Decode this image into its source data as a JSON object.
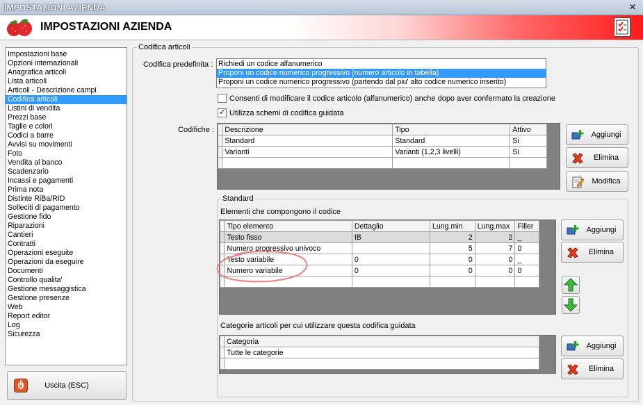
{
  "window": {
    "title": "IMPOSTAZIONI AZIENDA"
  },
  "header": {
    "title": "IMPOSTAZIONI AZIENDA"
  },
  "sidebar": {
    "items": [
      "Impostazioni base",
      "Opzioni internazionali",
      "Anagrafica articoli",
      "Lista articoli",
      "Articoli - Descrizione campi",
      "Codifica articoli",
      "Listini di vendita",
      "Prezzi base",
      "Taglie e colori",
      "Codici a barre",
      "Avvisi su movimenti",
      "Foto",
      "Vendita al banco",
      "Scadenzario",
      "Incassi e pagamenti",
      "Prima nota",
      "Distinte RiBa/RID",
      "Solleciti di pagamento",
      "Gestione fido",
      "Riparazioni",
      "Cantieri",
      "Contratti",
      "Operazioni eseguite",
      "Operazioni da eseguire",
      "Documenti",
      "Controllo qualita'",
      "Gestione messaggistica",
      "Gestione presenze",
      "Web",
      "Report editor",
      "Log",
      "Sicurezza"
    ],
    "selected_index": 5
  },
  "exit_button": {
    "label": "Uscita (ESC)"
  },
  "codifica": {
    "group_label": "Codifica articoli",
    "predefinita_label": "Codifica predefinita :",
    "options": [
      "Richiedi un codice alfanumerico",
      "Proponi un codice numerico progressivo (numero articolo in tabella)",
      "Proponi un codice numerico progressivo (partendo dal piu' alto codice numerico inserito)"
    ],
    "selected_option": 1,
    "checkbox_modify": {
      "label": "Consenti di modificare il codice articolo (alfanumerico) anche dopo aver confermato la creazione",
      "checked": false
    },
    "checkbox_schemi": {
      "label": "Utilizza schemi di codifica guidata",
      "checked": true
    },
    "codifiche_label": "Codifiche :",
    "codifiche_table": {
      "headers": [
        "Descrizione",
        "Tipo",
        "Attivo"
      ],
      "rows": [
        [
          "Standard",
          "Standard",
          "Si"
        ],
        [
          "Varianti",
          "Varianti (1,2,3 livelli)",
          "Si"
        ]
      ]
    },
    "buttons": {
      "aggiungi": "Aggiungi",
      "elimina": "Elimina",
      "modifica": "Modifica"
    }
  },
  "standard": {
    "group_label": "Standard",
    "elementi_label": "Elementi che compongono il codice",
    "elementi_table": {
      "headers": [
        "Tipo elemento",
        "Dettaglio",
        "Lung.min",
        "Lung.max",
        "Filler"
      ],
      "rows": [
        [
          "Testo fisso",
          "IB",
          "2",
          "2",
          "_"
        ],
        [
          "Numero progressivo univoco",
          "",
          "5",
          "7",
          "0"
        ],
        [
          "Testo variabile",
          "0",
          "0",
          "0",
          "_"
        ],
        [
          "Numero variabile",
          "0",
          "0",
          "0",
          "0"
        ]
      ]
    },
    "categorie_label": "Categorie articoli per cui utilizzare questa codifica guidata",
    "categorie_table": {
      "headers": [
        "Categoria"
      ],
      "rows": [
        [
          "Tutte le categorie"
        ]
      ]
    },
    "buttons": {
      "aggiungi": "Aggiungi",
      "elimina": "Elimina"
    }
  },
  "colors": {
    "selection": "#3399ff",
    "accent_red": "#ff1a1a",
    "highlight_circle": "#e88080"
  }
}
